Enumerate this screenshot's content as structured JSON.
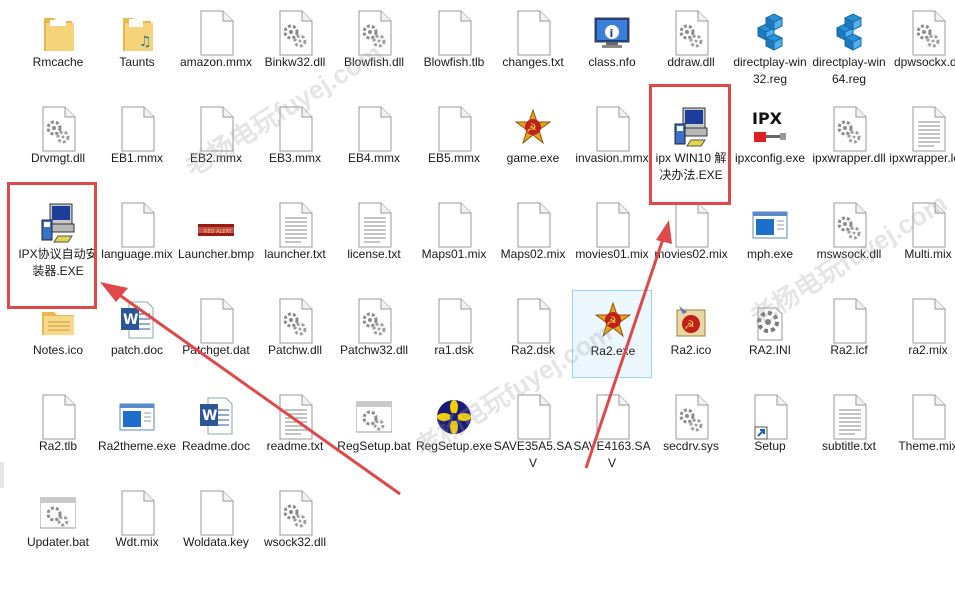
{
  "files": [
    {
      "name": "Rmcache",
      "type": "folder"
    },
    {
      "name": "Taunts",
      "type": "folder-music"
    },
    {
      "name": "amazon.mmx",
      "type": "blank"
    },
    {
      "name": "Binkw32.dll",
      "type": "dll"
    },
    {
      "name": "Blowfish.dll",
      "type": "dll"
    },
    {
      "name": "Blowfish.tlb",
      "type": "blank"
    },
    {
      "name": "changes.txt",
      "type": "blank"
    },
    {
      "name": "class.nfo",
      "type": "sysinfo"
    },
    {
      "name": "ddraw.dll",
      "type": "dll"
    },
    {
      "name": "directplay-win32.reg",
      "type": "reg"
    },
    {
      "name": "directplay-win64.reg",
      "type": "reg"
    },
    {
      "name": "dpwsockx.dll",
      "type": "dll"
    },
    {
      "name": "Drvmgt.dll",
      "type": "dll"
    },
    {
      "name": "EB1.mmx",
      "type": "blank"
    },
    {
      "name": "EB2.mmx",
      "type": "blank"
    },
    {
      "name": "EB3.mmx",
      "type": "blank"
    },
    {
      "name": "EB4.mmx",
      "type": "blank"
    },
    {
      "name": "EB5.mmx",
      "type": "blank"
    },
    {
      "name": "game.exe",
      "type": "soviet"
    },
    {
      "name": "invasion.mmx",
      "type": "blank"
    },
    {
      "name": "ipx WIN10 解决办法.EXE",
      "type": "installer"
    },
    {
      "name": "ipxconfig.exe",
      "type": "ipx"
    },
    {
      "name": "ipxwrapper.dll",
      "type": "dll"
    },
    {
      "name": "ipxwrapper.log",
      "type": "text"
    },
    {
      "name": "IPX协议自动安装器.EXE",
      "type": "installer"
    },
    {
      "name": "language.mix",
      "type": "blank"
    },
    {
      "name": "Launcher.bmp",
      "type": "bmp"
    },
    {
      "name": "launcher.txt",
      "type": "text"
    },
    {
      "name": "license.txt",
      "type": "text"
    },
    {
      "name": "Maps01.mix",
      "type": "blank"
    },
    {
      "name": "Maps02.mix",
      "type": "blank"
    },
    {
      "name": "movies01.mix",
      "type": "blank"
    },
    {
      "name": "movies02.mix",
      "type": "blank"
    },
    {
      "name": "mph.exe",
      "type": "window"
    },
    {
      "name": "mswsock.dll",
      "type": "dll"
    },
    {
      "name": "Multi.mix",
      "type": "blank"
    },
    {
      "name": "Notes.ico",
      "type": "folder-notes"
    },
    {
      "name": "patch.doc",
      "type": "word"
    },
    {
      "name": "Patchget.dat",
      "type": "blank"
    },
    {
      "name": "Patchw.dll",
      "type": "dll"
    },
    {
      "name": "Patchw32.dll",
      "type": "dll"
    },
    {
      "name": "ra1.dsk",
      "type": "blank"
    },
    {
      "name": "Ra2.dsk",
      "type": "blank"
    },
    {
      "name": "Ra2.exe",
      "type": "soviet"
    },
    {
      "name": "Ra2.ico",
      "type": "ra2ico"
    },
    {
      "name": "RA2.INI",
      "type": "ini"
    },
    {
      "name": "Ra2.lcf",
      "type": "blank"
    },
    {
      "name": "ra2.mix",
      "type": "blank"
    },
    {
      "name": "Ra2.tlb",
      "type": "blank"
    },
    {
      "name": "Ra2theme.exe",
      "type": "window"
    },
    {
      "name": "Readme.doc",
      "type": "word"
    },
    {
      "name": "readme.txt",
      "type": "text"
    },
    {
      "name": "RegSetup.bat",
      "type": "batch"
    },
    {
      "name": "RegSetup.exe",
      "type": "yellowstar"
    },
    {
      "name": "SAVE35A5.SAV",
      "type": "blank"
    },
    {
      "name": "SAVE4163.SAV",
      "type": "blank"
    },
    {
      "name": "secdrv.sys",
      "type": "dll"
    },
    {
      "name": "Setup",
      "type": "shortcut"
    },
    {
      "name": "subtitle.txt",
      "type": "text"
    },
    {
      "name": "Theme.mix",
      "type": "blank"
    },
    {
      "name": "Updater.bat",
      "type": "batch"
    },
    {
      "name": "Wdt.mix",
      "type": "blank"
    },
    {
      "name": "Woldata.key",
      "type": "blank"
    },
    {
      "name": "wsock32.dll",
      "type": "dll"
    }
  ],
  "selected_file": "Ra2.exe",
  "highlighted_files": [
    "ipx WIN10 解决办法.EXE",
    "IPX协议自动安装器.EXE"
  ],
  "watermark": "老杨电玩fuyej.com",
  "colors": {
    "highlight": "#e0494a",
    "folder": "#f5c95f",
    "selection": "#cce8ff"
  }
}
